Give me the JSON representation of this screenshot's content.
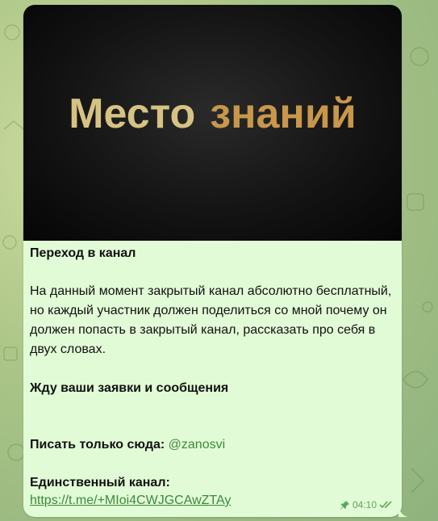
{
  "banner": {
    "word1": "Место",
    "word2": "знаний"
  },
  "message": {
    "title": "Переход в канал",
    "paragraph": "На данный момент закрытый канал абсолютно бесплатный, но каждый участник должен поделиться со мной почему он должен попасть в закрытый канал, рассказать про себя в двух словах.",
    "waiting": "Жду ваши заявки и сообщения",
    "contact_label": "Писать только сюда:",
    "contact_handle": "@zanosvi",
    "channel_label": "Единственный канал:",
    "channel_link": "https://t.me/+MIoi4CWJGCAwZTAy"
  },
  "meta": {
    "time": "04:10",
    "pin_icon": "pin-icon",
    "status_icon": "double-check-icon"
  },
  "colors": {
    "bubble": "#e2fbd7",
    "link": "#3b8a3b",
    "banner_word1": "#d6c383",
    "banner_word2": "#c8974b"
  }
}
